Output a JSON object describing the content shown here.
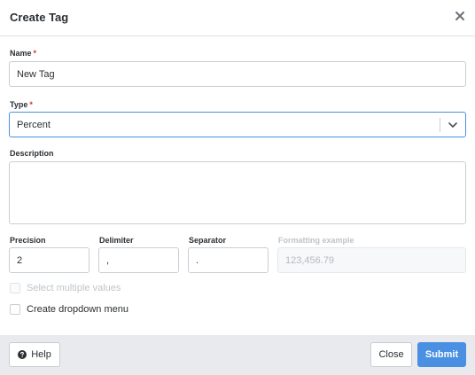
{
  "dialog": {
    "title": "Create Tag"
  },
  "form": {
    "name_label": "Name",
    "name_value": "New Tag",
    "type_label": "Type",
    "type_value": "Percent",
    "description_label": "Description",
    "description_value": "",
    "precision_label": "Precision",
    "precision_value": "2",
    "delimiter_label": "Delimiter",
    "delimiter_value": ",",
    "separator_label": "Separator",
    "separator_value": ".",
    "formatting_example_label": "Formatting example",
    "formatting_example_value": "123,456.79",
    "required_marker": "*",
    "select_multiple_label": "Select multiple values",
    "create_dropdown_label": "Create dropdown menu"
  },
  "footer": {
    "help_label": "Help",
    "close_label": "Close",
    "submit_label": "Submit"
  },
  "colors": {
    "accent": "#4a90e2",
    "required": "#d9302c",
    "footer_bg": "#e8eaed"
  }
}
